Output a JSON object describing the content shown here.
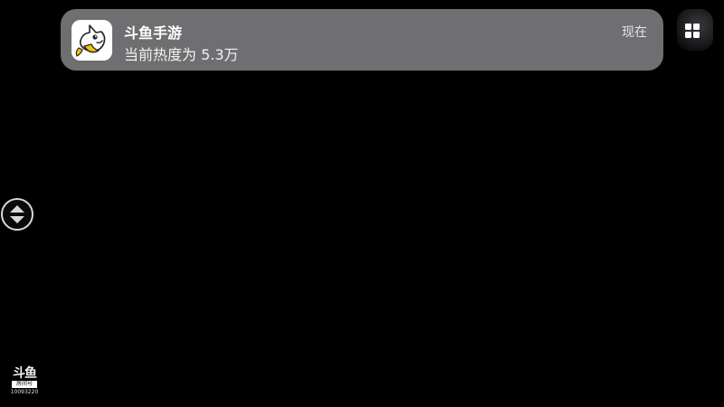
{
  "notification": {
    "app_name": "斗鱼手游",
    "message": "当前热度为 5.3万",
    "time": "现在",
    "icon": "douyu-shark-app-icon"
  },
  "overlay": {
    "grid_icon": "grid-icon",
    "scroll_toggle_icon": "up-down-arrows-icon"
  },
  "watermark": {
    "logo": "斗鱼",
    "tag": "房间号",
    "room_id": "10093220"
  },
  "colors": {
    "background": "#000000",
    "notification_bg": "#6f6f72",
    "brand_yellow": "#f4c20d"
  }
}
